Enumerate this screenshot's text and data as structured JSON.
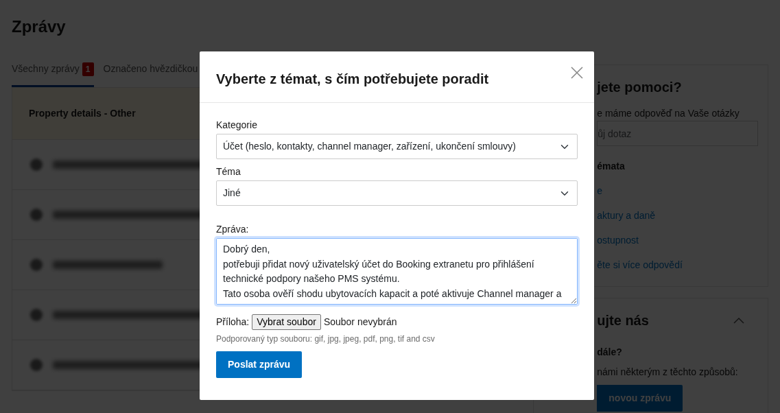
{
  "page": {
    "title": "Zprávy"
  },
  "tabs": [
    {
      "label": "Všechny zprávy",
      "badge": "1",
      "selected": true
    },
    {
      "label": "Označeno hvězdičkou",
      "selected": false
    }
  ],
  "message_list": {
    "header": "Property details - Other",
    "rows": [
      {
        "kind": "blurred"
      },
      {
        "kind": "blurred"
      },
      {
        "kind": "blurred"
      },
      {
        "kind": "blurred"
      },
      {
        "kind": "blurred"
      }
    ]
  },
  "help_panel": {
    "title": "jete pomoci?",
    "subtitle": "e máme odpověď na Vaše otázky",
    "search": {
      "placeholder": "ůj dotaz"
    },
    "topics_heading": "émata",
    "topics": [
      "e",
      "aktury a daně",
      "ostupnost",
      "ěte si více odpovědí"
    ]
  },
  "contact_panel": {
    "title": "ujte nás",
    "expanded": true,
    "question": "dále?",
    "text": "námi některým z těchto způsobů:",
    "button": "novou zprávu"
  },
  "modal": {
    "title": "Vyberte z témat, s čím potřebujete poradit",
    "fields": [
      {
        "kind": "select",
        "label": "Kategorie",
        "value": "Účet (heslo, kontakty, channel manager, zařízení, ukončení smlouvy)"
      },
      {
        "kind": "select",
        "label": "Téma",
        "value": "Jiné"
      },
      {
        "kind": "textarea",
        "label": "Zpráva:",
        "value": "Dobrý den,\npotřebuji přidat nový uživatelský účet do Booking extranetu pro přihlášení technické podpory našeho PMS systému.\nTato osoba ověří shodu ubytovacích kapacit a poté aktivuje Channel manager a"
      }
    ],
    "attachment": {
      "label": "Příloha:",
      "button": "Vybrat soubor",
      "status": "Soubor nevybrán",
      "hint": "Podporovaný typ souboru: gif, jpg, jpeg, pdf, png, tif and csv"
    },
    "submit": "Poslat zprávu"
  }
}
